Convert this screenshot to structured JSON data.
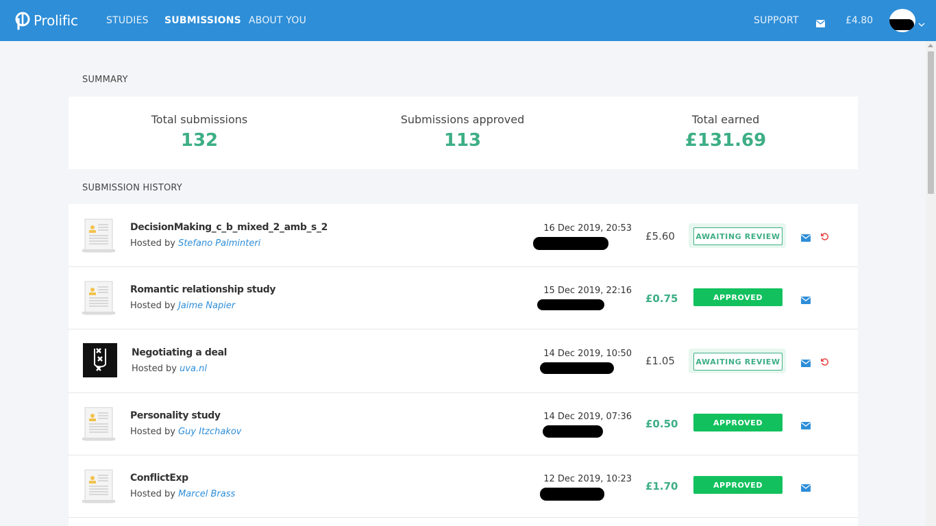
{
  "colors": {
    "nav_bg": "#2e8ed8",
    "accent_green": "#3dae85",
    "approved_bg": "#12c15e",
    "link_blue": "#2e8ed8",
    "undo_red": "#e84a4a"
  },
  "header": {
    "logo_text": "Prolific",
    "nav": [
      "STUDIES",
      "SUBMISSIONS",
      "ABOUT YOU"
    ],
    "active_nav": "SUBMISSIONS",
    "support_label": "SUPPORT",
    "balance": "£4.80",
    "icons": {
      "messages": "envelope-icon",
      "menu": "chevron-down-icon"
    }
  },
  "summary": {
    "heading": "SUMMARY",
    "stats": [
      {
        "label": "Total submissions",
        "value": "132"
      },
      {
        "label": "Submissions approved",
        "value": "113"
      },
      {
        "label": "Total earned",
        "value": "£131.69"
      }
    ]
  },
  "history": {
    "heading": "SUBMISSION HISTORY",
    "hosted_prefix": "Hosted by",
    "rows": [
      {
        "name": "DecisionMaking_c_b_mixed_2_amb_s_2",
        "host": "Stefano Palminteri",
        "date": "16 Dec 2019, 20:53",
        "reward": "£5.60",
        "status": "AWAITING REVIEW",
        "thumb": "document-icon"
      },
      {
        "name": "Romantic relationship study",
        "host": "Jaime Napier",
        "date": "15 Dec 2019, 22:16",
        "reward": "£0.75",
        "status": "APPROVED",
        "thumb": "document-icon"
      },
      {
        "name": "Negotiating a deal",
        "host": "uva.nl",
        "date": "14 Dec 2019, 10:50",
        "reward": "£1.05",
        "status": "AWAITING REVIEW",
        "thumb": "uva-logo-icon"
      },
      {
        "name": "Personality study",
        "host": "Guy Itzchakov",
        "date": "14 Dec 2019, 07:36",
        "reward": "£0.50",
        "status": "APPROVED",
        "thumb": "document-icon"
      },
      {
        "name": "ConflictExp",
        "host": "Marcel Brass",
        "date": "12 Dec 2019, 10:23",
        "reward": "£1.70",
        "status": "APPROVED",
        "thumb": "document-icon"
      }
    ]
  }
}
